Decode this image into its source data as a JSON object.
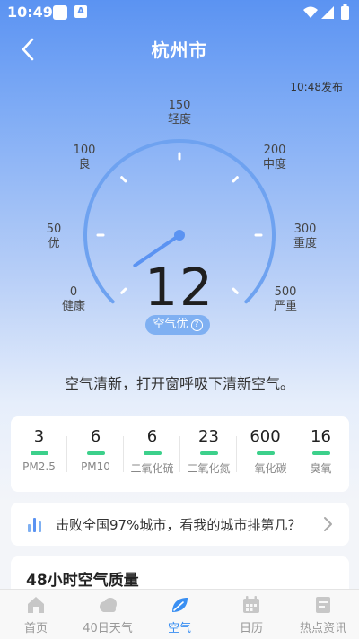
{
  "status_bar": {
    "time": "10:49",
    "notif_a": "A"
  },
  "header": {
    "title": "杭州市"
  },
  "publish_time": "10:48发布",
  "gauge": {
    "value": 12,
    "max": 500,
    "scale": [
      {
        "value": "0",
        "label": "健康"
      },
      {
        "value": "50",
        "label": "优"
      },
      {
        "value": "100",
        "label": "良"
      },
      {
        "value": "150",
        "label": "轻度"
      },
      {
        "value": "200",
        "label": "中度"
      },
      {
        "value": "300",
        "label": "重度"
      },
      {
        "value": "500",
        "label": "严重"
      }
    ],
    "aqi": "12",
    "quality": "空气优",
    "help_glyph": "?"
  },
  "advice": "空气清新，打开窗呼吸下清新空气。",
  "pollutants": [
    {
      "value": "3",
      "label": "PM2.5"
    },
    {
      "value": "6",
      "label": "PM10"
    },
    {
      "value": "6",
      "label": "二氧化硫"
    },
    {
      "value": "23",
      "label": "二氧化氮"
    },
    {
      "value": "600",
      "label": "一氧化碳"
    },
    {
      "value": "16",
      "label": "臭氧"
    }
  ],
  "ranking": {
    "text": "击败全国97%城市，看我的城市排第几？"
  },
  "hours": {
    "title": "48小时空气质量"
  },
  "tabs": [
    {
      "label": "首页",
      "icon": "home-icon"
    },
    {
      "label": "40日天气",
      "icon": "cloud-icon"
    },
    {
      "label": "空气",
      "icon": "leaf-icon",
      "active": true
    },
    {
      "label": "日历",
      "icon": "calendar-icon"
    },
    {
      "label": "热点资讯",
      "icon": "news-icon"
    }
  ],
  "colors": {
    "accent": "#3a8ff2",
    "good": "#3cd08b",
    "badge": "#7fb0f2"
  }
}
